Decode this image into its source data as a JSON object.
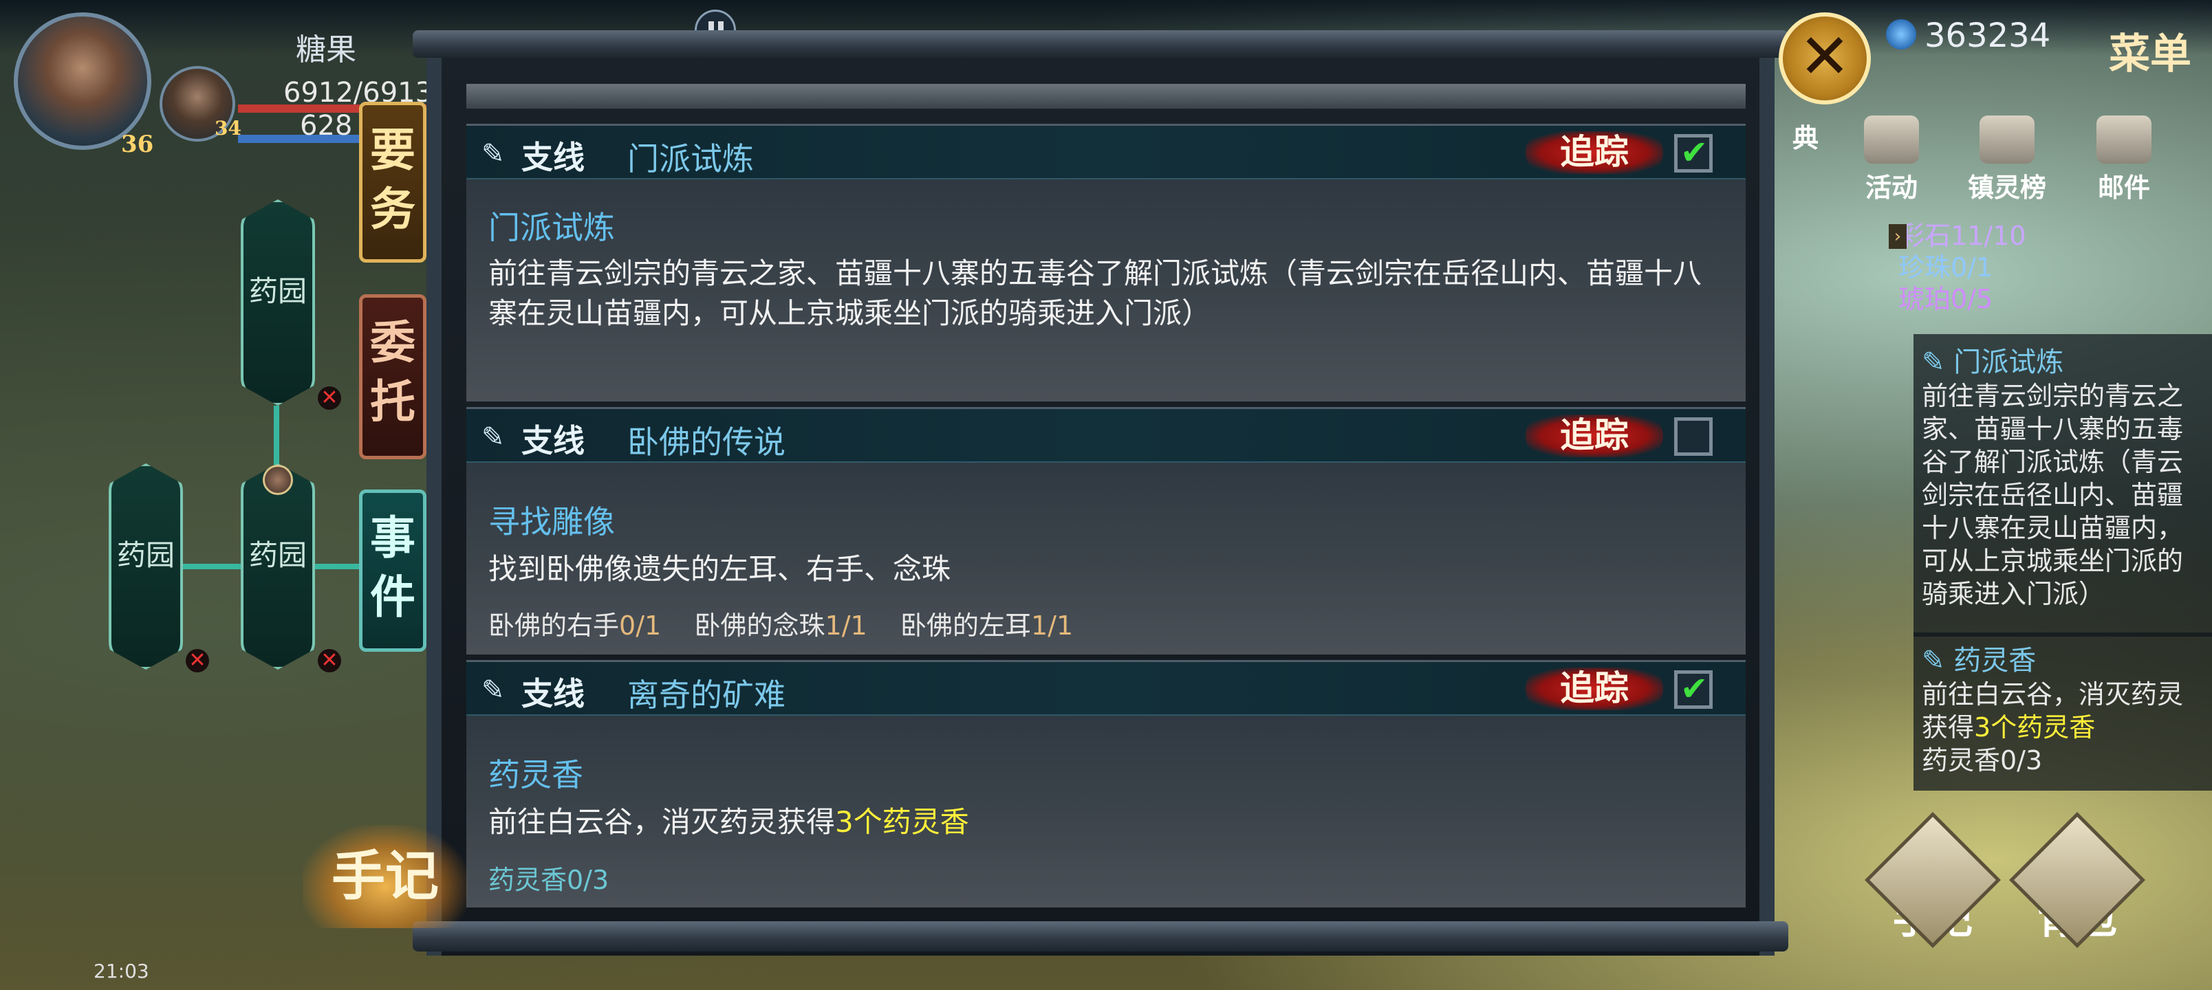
{
  "hud": {
    "player_name": "糖果",
    "hp": "6912/6913",
    "mp": "628",
    "main_level": "36",
    "companion_level": "34",
    "currency": "363234",
    "menu_label": "菜单"
  },
  "side_tabs": [
    "要务",
    "委托",
    "事件"
  ],
  "map_nodes": [
    "药园",
    "药园",
    "药园"
  ],
  "quest_cards": [
    {
      "branch": "支线",
      "name": "门派试炼",
      "track": "追踪",
      "checked": true,
      "objective_title": "门派试炼",
      "description": "前往青云剑宗的青云之家、苗疆十八寨的五毒谷了解门派试炼（青云剑宗在岳径山内、苗疆十八寨在灵山苗疆内，可从上京城乘坐门派的骑乘进入门派）"
    },
    {
      "branch": "支线",
      "name": "卧佛的传说",
      "track": "追踪",
      "checked": false,
      "objective_title": "寻找雕像",
      "description": "找到卧佛像遗失的左耳、右手、念珠",
      "progress": [
        {
          "label": "卧佛的右手",
          "value": "0/1"
        },
        {
          "label": "卧佛的念珠",
          "value": "1/1"
        },
        {
          "label": "卧佛的左耳",
          "value": "1/1"
        }
      ]
    },
    {
      "branch": "支线",
      "name": "离奇的矿难",
      "track": "追踪",
      "checked": true,
      "objective_title": "药灵香",
      "description_prefix": "前往白云谷，消灭药灵获得",
      "description_highlight": "3个药灵香",
      "progress_text": "药灵香0/3"
    }
  ],
  "right_menu": [
    "典",
    "活动",
    "镇灵榜",
    "邮件"
  ],
  "resources": [
    {
      "label": "彩石11/10",
      "color": "#c9a6ff"
    },
    {
      "label": "珍珠0/1",
      "color": "#8fc8ff"
    },
    {
      "label": "琥珀0/5",
      "color": "#d08cff"
    }
  ],
  "tracked_panel": [
    {
      "title": "门派试炼",
      "desc": "前往青云剑宗的青云之家、苗疆十八寨的五毒谷了解门派试炼（青云剑宗在岳径山内、苗疆十八寨在灵山苗疆内，可从上京城乘坐门派的骑乘进入门派）"
    },
    {
      "title": "药灵香",
      "desc_prefix": "前往白云谷，消灭药灵获得",
      "desc_highlight": "3个药灵香",
      "progress": "药灵香0/3"
    }
  ],
  "bottom_buttons": [
    "手记",
    "背包"
  ],
  "shouji_label": "手记",
  "status_time": "21:03"
}
